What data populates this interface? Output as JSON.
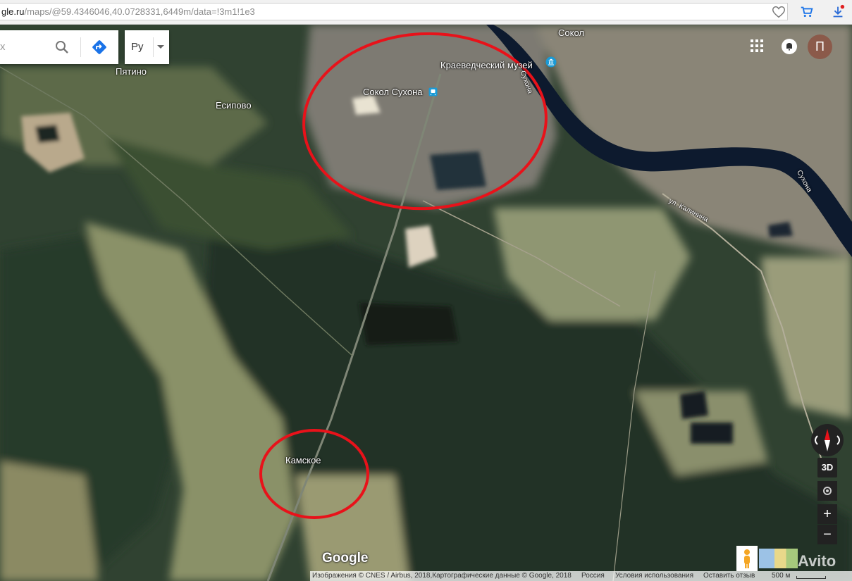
{
  "browser": {
    "url_prefix": "gle.ru",
    "url_rest": "/maps/@59.4346046,40.0728331,6449m/data=!3m1!1e3"
  },
  "search": {
    "partial_text": "х"
  },
  "language": {
    "label": "Ру"
  },
  "places": {
    "sokol": "Сокол",
    "pyatino": "Пятино",
    "esipovo": "Есипово",
    "museum": "Краеведческий музей",
    "station": "Сокол Сухона",
    "river1": "Сухона",
    "river2": "Сухона",
    "street": "ул. Калинина",
    "kamskoe": "Камское"
  },
  "controls": {
    "btn3d": "3D",
    "zoom_in": "+",
    "zoom_out": "−",
    "profile_letter": "П"
  },
  "footer": {
    "logo": "Google",
    "imagery": "Изображения © CNES / Airbus, 2018,Картографические данные © Google, 2018",
    "country": "Россия",
    "terms": "Условия использования",
    "feedback": "Оставить отзыв",
    "scale": "500 м"
  },
  "watermark": "Avito",
  "colors": {
    "annotation": "#e8121a",
    "river": "#0d1a2e"
  }
}
